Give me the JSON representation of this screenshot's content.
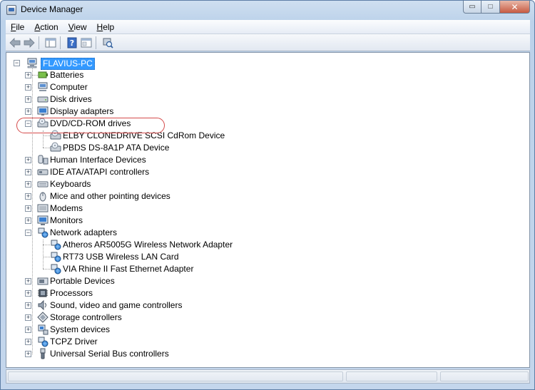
{
  "window": {
    "title": "Device Manager"
  },
  "caption": {
    "minimize": "▭",
    "maximize": "□",
    "close": "✕"
  },
  "menu": [
    {
      "label": "File",
      "accel": "F",
      "rest": "ile"
    },
    {
      "label": "Action",
      "accel": "A",
      "rest": "ction"
    },
    {
      "label": "View",
      "accel": "V",
      "rest": "iew"
    },
    {
      "label": "Help",
      "accel": "H",
      "rest": "elp"
    }
  ],
  "toolbar": {
    "buttons": [
      {
        "name": "back-button",
        "icon": "back-arrow-icon"
      },
      {
        "name": "forward-button",
        "icon": "forward-arrow-icon"
      },
      {
        "name": "show-hide-console-tree-button",
        "icon": "console-tree-icon"
      },
      {
        "name": "help-button",
        "icon": "help-icon"
      },
      {
        "name": "properties-button",
        "icon": "properties-icon"
      },
      {
        "name": "scan-hardware-button",
        "icon": "scan-hardware-icon"
      }
    ]
  },
  "tree": {
    "root": "FLAVIUS-PC",
    "categories": {
      "batteries": "Batteries",
      "computer": "Computer",
      "disk_drives": "Disk drives",
      "display_adapters": "Display adapters",
      "dvd_cdrom": "DVD/CD-ROM drives",
      "human_interface": "Human Interface Devices",
      "ide_ata": "IDE ATA/ATAPI controllers",
      "keyboards": "Keyboards",
      "mice": "Mice and other pointing devices",
      "modems": "Modems",
      "monitors": "Monitors",
      "network": "Network adapters",
      "portable": "Portable Devices",
      "processors": "Processors",
      "sound": "Sound, video and game controllers",
      "storage": "Storage controllers",
      "system": "System devices",
      "tcpz": "TCPZ Driver",
      "usb": "Universal Serial Bus controllers"
    },
    "dvd_children": [
      "ELBY CLONEDRIVE SCSI CdRom Device",
      "PBDS DS-8A1P ATA Device"
    ],
    "network_children": [
      "Atheros AR5005G Wireless Network Adapter",
      "RT73 USB Wireless LAN Card",
      "VIA Rhine II Fast Ethernet Adapter"
    ],
    "expand_plus": "+",
    "expand_minus": "−"
  },
  "colors": {
    "selection": "#3399ff",
    "highlight_ring": "#d54b4b"
  }
}
